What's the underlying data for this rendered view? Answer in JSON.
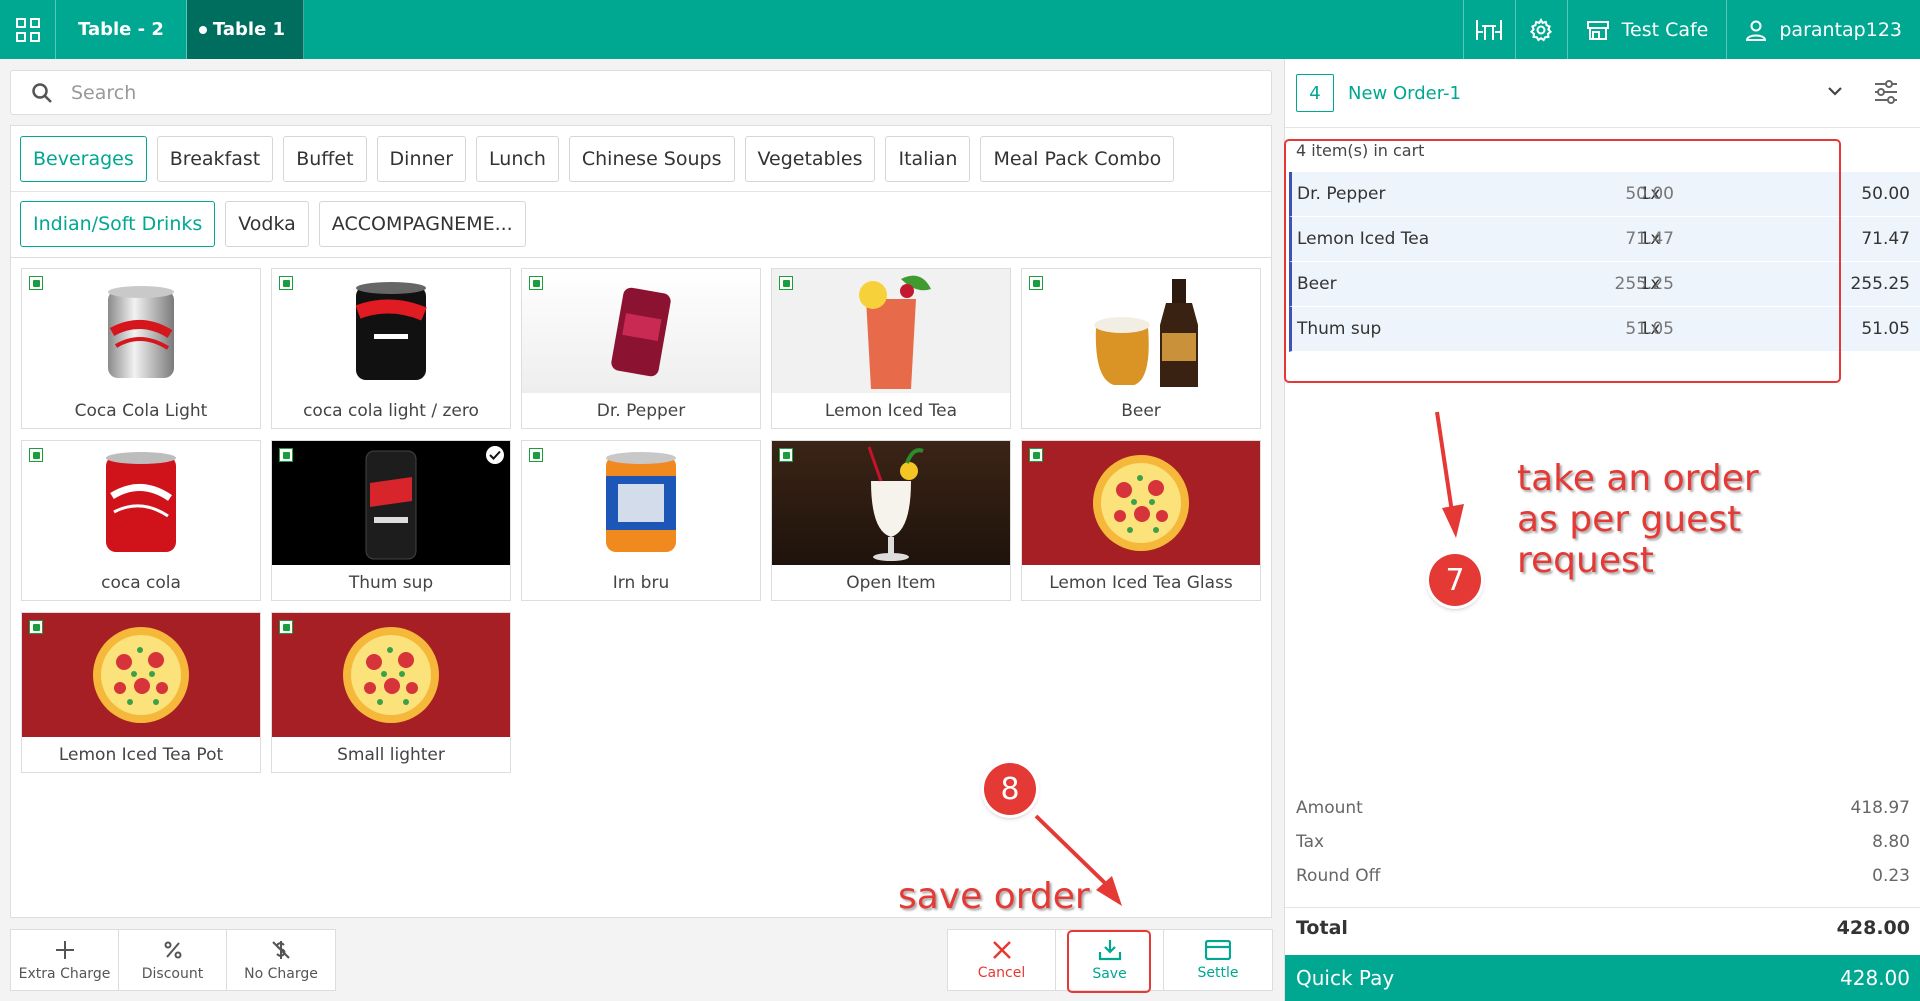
{
  "topbar": {
    "tabs": [
      {
        "label": "Table - 2"
      },
      {
        "label": "Table 1"
      }
    ],
    "cafe_name": "Test Cafe",
    "user_name": "parantap123"
  },
  "search": {
    "placeholder": "Search"
  },
  "categories": {
    "row1": [
      "Beverages",
      "Breakfast",
      "Buffet",
      "Dinner",
      "Lunch",
      "Chinese Soups",
      "Vegetables",
      "Italian",
      "Meal Pack Combo"
    ],
    "row2": [
      "Indian/Soft Drinks",
      "Vodka",
      "ACCOMPAGNEME..."
    ]
  },
  "products": [
    {
      "name": "Coca Cola Light"
    },
    {
      "name": "coca cola light / zero"
    },
    {
      "name": "Dr. Pepper"
    },
    {
      "name": "Lemon Iced Tea"
    },
    {
      "name": "Beer"
    },
    {
      "name": "coca cola"
    },
    {
      "name": "Thum sup"
    },
    {
      "name": "Irn bru"
    },
    {
      "name": "Open Item"
    },
    {
      "name": "Lemon Iced Tea Glass"
    },
    {
      "name": "Lemon Iced Tea Pot"
    },
    {
      "name": "Small lighter"
    }
  ],
  "bottom_buttons": {
    "extra_charge": "Extra Charge",
    "discount": "Discount",
    "no_charge": "No Charge"
  },
  "actions": {
    "cancel": "Cancel",
    "save": "Save",
    "settle": "Settle"
  },
  "order": {
    "number": "4",
    "name": "New Order-1",
    "cart_count": "4 item(s) in cart",
    "items": [
      {
        "name": "Dr. Pepper",
        "qty": "1x",
        "price": "50.00",
        "total": "50.00"
      },
      {
        "name": "Lemon Iced Tea",
        "qty": "1x",
        "price": "71.47",
        "total": "71.47"
      },
      {
        "name": "Beer",
        "qty": "1x",
        "price": "255.25",
        "total": "255.25"
      },
      {
        "name": "Thum sup",
        "qty": "1x",
        "price": "51.05",
        "total": "51.05"
      }
    ],
    "amount_label": "Amount",
    "amount": "418.97",
    "tax_label": "Tax",
    "tax": "8.80",
    "round_off_label": "Round Off",
    "round_off": "0.23",
    "total_label": "Total",
    "total": "428.00",
    "quick_pay_label": "Quick Pay",
    "quick_pay": "428.00"
  },
  "annotations": {
    "step7_text_lines": [
      "take an order",
      "as per guest",
      "request"
    ],
    "step7_number": "7",
    "step8_text": "save order",
    "step8_number": "8"
  },
  "colors": {
    "brand": "#00a891",
    "brand_dark": "#006e5f",
    "annotation": "#e53935",
    "cart_row_bg": "#eef4fb",
    "cart_row_accent": "#3f51b5"
  }
}
